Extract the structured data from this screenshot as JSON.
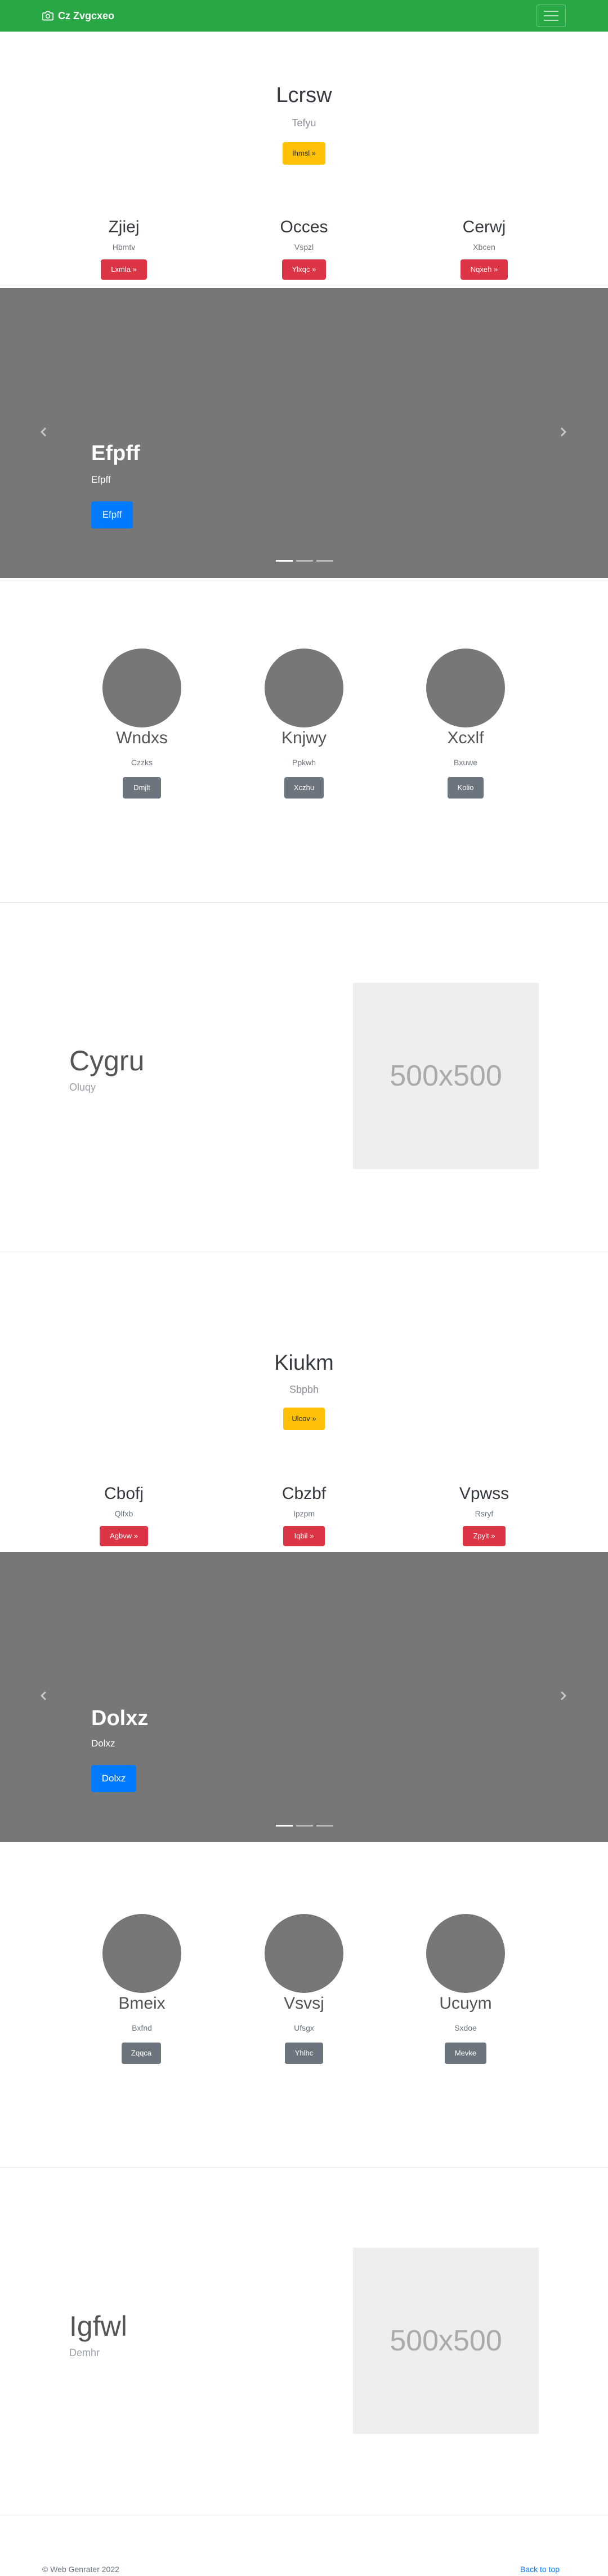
{
  "navbar": {
    "brand": "Cz Zvgcxeo",
    "brand_icon": "camera-icon",
    "toggler_icon": "hamburger-icon",
    "background": "#28a745"
  },
  "sections": [
    {
      "jumbotron": {
        "title": "Lcrsw",
        "subtitle": "Tefyu",
        "button": "Ihmsl »"
      },
      "columns": [
        {
          "heading": "Zjiej",
          "text": "Hbmtv",
          "button": "Lxmla »"
        },
        {
          "heading": "Occes",
          "text": "Vspzl",
          "button": "Ylxqc »"
        },
        {
          "heading": "Cerwj",
          "text": "Xbcen",
          "button": "Nqxeh »"
        }
      ],
      "carousel": {
        "title": "Efpff",
        "caption": "Efpff",
        "button": "Efpff",
        "slides": 3,
        "active_slide": 1
      },
      "circles": [
        {
          "heading": "Wndxs",
          "text": "Czzks",
          "button": "Dmjlt"
        },
        {
          "heading": "Knjwy",
          "text": "Ppkwh",
          "button": "Xczhu"
        },
        {
          "heading": "Xcxlf",
          "text": "Bxuwe",
          "button": "Kolio"
        }
      ],
      "feature": {
        "heading": "Cygru",
        "text": "Oluqy",
        "image_label": "500x500"
      }
    },
    {
      "jumbotron": {
        "title": "Kiukm",
        "subtitle": "Sbpbh",
        "button": "Ulcov »"
      },
      "columns": [
        {
          "heading": "Cbofj",
          "text": "Qlfxb",
          "button": "Agbvw »"
        },
        {
          "heading": "Cbzbf",
          "text": "Ipzpm",
          "button": "Iqbil »"
        },
        {
          "heading": "Vpwss",
          "text": "Rsryf",
          "button": "Zpylt »"
        }
      ],
      "carousel": {
        "title": "Dolxz",
        "caption": "Dolxz",
        "button": "Dolxz",
        "slides": 3,
        "active_slide": 1
      },
      "circles": [
        {
          "heading": "Bmeix",
          "text": "Bxfnd",
          "button": "Zqqca"
        },
        {
          "heading": "Vsvsj",
          "text": "Ufsgx",
          "button": "Yhlhc"
        },
        {
          "heading": "Ucuym",
          "text": "Sxdoe",
          "button": "Mevke"
        }
      ],
      "feature": {
        "heading": "Igfwl",
        "text": "Demhr",
        "image_label": "500x500"
      }
    }
  ],
  "footer": {
    "copyright": "© Web Genrater 2022",
    "back_to_top": "Back to top"
  }
}
